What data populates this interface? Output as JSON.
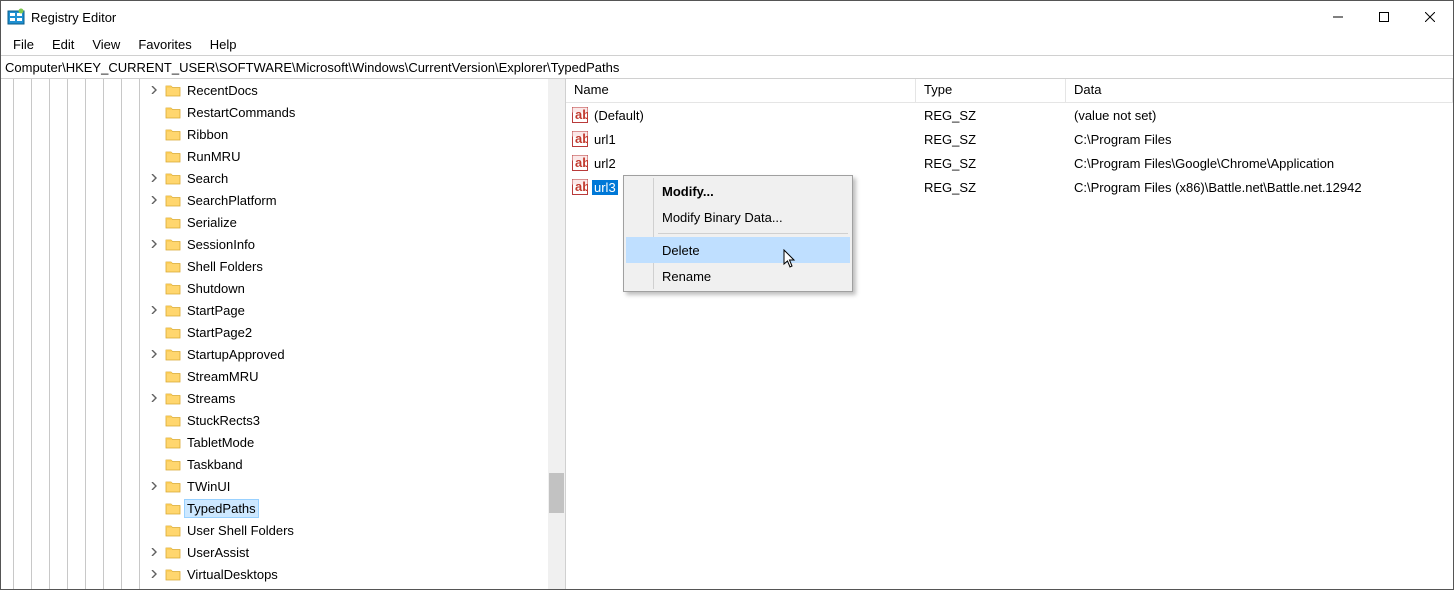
{
  "title": "Registry Editor",
  "menu": {
    "file": "File",
    "edit": "Edit",
    "view": "View",
    "favorites": "Favorites",
    "help": "Help"
  },
  "address": "Computer\\HKEY_CURRENT_USER\\SOFTWARE\\Microsoft\\Windows\\CurrentVersion\\Explorer\\TypedPaths",
  "tree": {
    "items": [
      {
        "label": "RecentDocs",
        "expandable": true
      },
      {
        "label": "RestartCommands",
        "expandable": false
      },
      {
        "label": "Ribbon",
        "expandable": false
      },
      {
        "label": "RunMRU",
        "expandable": false
      },
      {
        "label": "Search",
        "expandable": true
      },
      {
        "label": "SearchPlatform",
        "expandable": true
      },
      {
        "label": "Serialize",
        "expandable": false
      },
      {
        "label": "SessionInfo",
        "expandable": true
      },
      {
        "label": "Shell Folders",
        "expandable": false
      },
      {
        "label": "Shutdown",
        "expandable": false
      },
      {
        "label": "StartPage",
        "expandable": true
      },
      {
        "label": "StartPage2",
        "expandable": false
      },
      {
        "label": "StartupApproved",
        "expandable": true
      },
      {
        "label": "StreamMRU",
        "expandable": false
      },
      {
        "label": "Streams",
        "expandable": true
      },
      {
        "label": "StuckRects3",
        "expandable": false
      },
      {
        "label": "TabletMode",
        "expandable": false
      },
      {
        "label": "Taskband",
        "expandable": false
      },
      {
        "label": "TWinUI",
        "expandable": true
      },
      {
        "label": "TypedPaths",
        "expandable": false,
        "selected": true
      },
      {
        "label": "User Shell Folders",
        "expandable": false
      },
      {
        "label": "UserAssist",
        "expandable": true
      },
      {
        "label": "VirtualDesktops",
        "expandable": true
      }
    ]
  },
  "list": {
    "columns": {
      "name": "Name",
      "type": "Type",
      "data": "Data"
    },
    "rows": [
      {
        "name": "(Default)",
        "type": "REG_SZ",
        "data": "(value not set)"
      },
      {
        "name": "url1",
        "type": "REG_SZ",
        "data": "C:\\Program Files"
      },
      {
        "name": "url2",
        "type": "REG_SZ",
        "data": "C:\\Program Files\\Google\\Chrome\\Application"
      },
      {
        "name": "url3",
        "type": "REG_SZ",
        "data": "C:\\Program Files (x86)\\Battle.net\\Battle.net.12942",
        "selected": true
      }
    ]
  },
  "context_menu": {
    "modify": "Modify...",
    "modify_binary": "Modify Binary Data...",
    "delete": "Delete",
    "rename": "Rename"
  }
}
